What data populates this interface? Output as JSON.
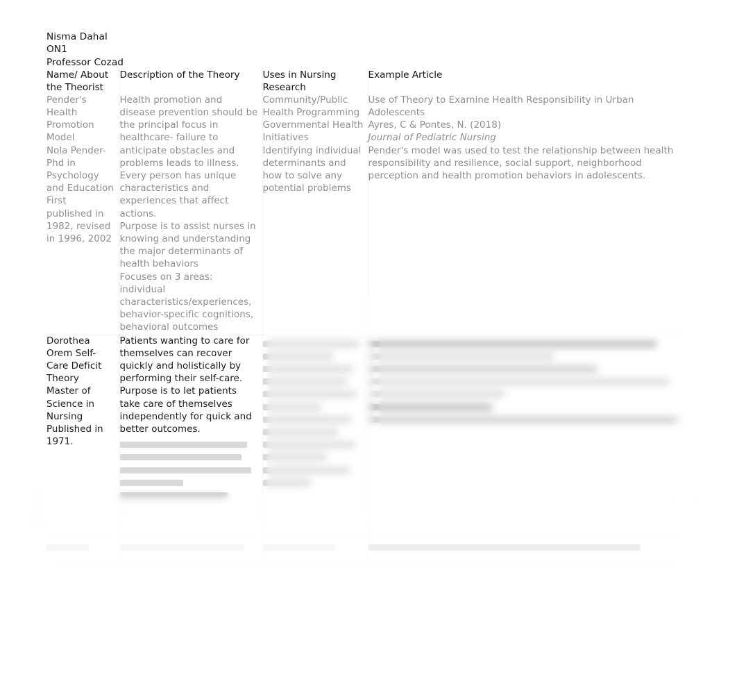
{
  "document": {
    "heading": [
      "Nisma Dahal",
      "ON1",
      "Professor Cozad"
    ]
  },
  "table": {
    "columns": [
      "Name/ About the Theorist",
      "Description of the Theory",
      "Uses in Nursing Research",
      "Example Article"
    ],
    "rows": [
      {
        "id": "row-pender",
        "legible": true,
        "name_about": [
          "Pender's Health Promotion Model",
          "Nola Pender- Phd in Psychology and Education",
          "First published in 1982, revised in 1996, 2002"
        ],
        "description": [
          "Health promotion and disease prevention should be the principal focus in healthcare- failure to anticipate obstacles and problems leads to illness.",
          "Every person has unique characteristics and experiences that affect actions.",
          "Purpose is to assist nurses in knowing and understanding the major determinants of health behaviors",
          "Focuses on 3 areas: individual characteristics/experiences, behavior-specific cognitions, behavioral outcomes"
        ],
        "uses_in_research": [
          "Community/Public Health Programming",
          "Governmental Health Initiatives",
          "Identifying individual determinants and how to solve any potential problems"
        ],
        "example_article": {
          "title": "Use of Theory to Examine Health Responsibility in Urban Adolescents",
          "authors": "Ayres, C & Pontes, N. (2018)",
          "journal": "Journal of Pediatric Nursing",
          "summary": "Pender's model was used to test the relationship between health responsibility and resilience, social support, neighborhood perception and health promotion behaviors in adolescents."
        }
      },
      {
        "id": "row-orem",
        "legible": false,
        "name_about": [
          "Dorothea Orem Self-Care Deficit Theory",
          "Master of Science in Nursing",
          "Published in 1971."
        ],
        "description": [
          "Patients wanting to care for themselves can recover quickly and holistically by performing their self-care.",
          "Purpose is to let patients take care of themselves independently for quick and better outcomes."
        ],
        "uses_in_research": [],
        "example_article": {
          "title": "",
          "authors": "",
          "journal": "",
          "summary": ""
        }
      },
      {
        "id": "row-third-partial",
        "legible": false,
        "name_about": [],
        "description": [],
        "uses_in_research": [],
        "example_article": {
          "title": "",
          "authors": "",
          "journal": "",
          "summary": ""
        }
      }
    ]
  },
  "rendering": {
    "background_color": "#ffffff",
    "heading_text_color": "#111111",
    "header_text_color": "#141414",
    "row1_text_color": "#8e8e8e",
    "row2_text_color": "#1a1a1a",
    "grid_line_color": "#f2f2f2"
  }
}
